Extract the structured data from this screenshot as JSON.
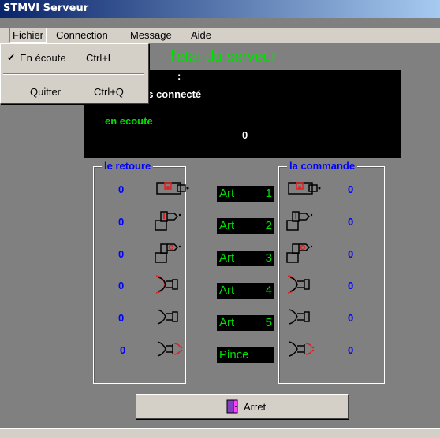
{
  "window": {
    "title": "STMVI Serveur"
  },
  "menubar": {
    "items": [
      "Fichier",
      "Connection",
      "Message",
      "Aide"
    ]
  },
  "file_menu": {
    "items": [
      {
        "label": "En écoute",
        "shortcut": "Ctrl+L",
        "checked": true
      },
      {
        "label": "Quitter",
        "shortcut": "Ctrl+Q",
        "checked": false
      }
    ]
  },
  "server": {
    "title": "l'etat du serveur",
    "colon": ":",
    "connection_status": "as connecté",
    "listen_status": "en ecoute",
    "count": "0"
  },
  "retour": {
    "legend": "le retoure",
    "values": [
      "0",
      "0",
      "0",
      "0",
      "0",
      "0"
    ]
  },
  "commande": {
    "legend": "la commande",
    "values": [
      "0",
      "0",
      "0",
      "0",
      "0",
      "0"
    ]
  },
  "articulations": [
    {
      "label": "Art",
      "num": "1"
    },
    {
      "label": "Art",
      "num": "2"
    },
    {
      "label": "Art",
      "num": "3"
    },
    {
      "label": "Art",
      "num": "4"
    },
    {
      "label": "Art",
      "num": "5"
    },
    {
      "label": "Pince",
      "num": ""
    }
  ],
  "icons": [
    "robot-joint-1-icon",
    "robot-joint-2-icon",
    "robot-joint-3-icon",
    "robot-joint-4-icon",
    "robot-joint-5-icon",
    "gripper-icon"
  ],
  "buttons": {
    "stop_label": "Arret"
  },
  "colors": {
    "accent_green": "#00e000",
    "value_blue": "#0000ff",
    "panel_black": "#000000"
  }
}
